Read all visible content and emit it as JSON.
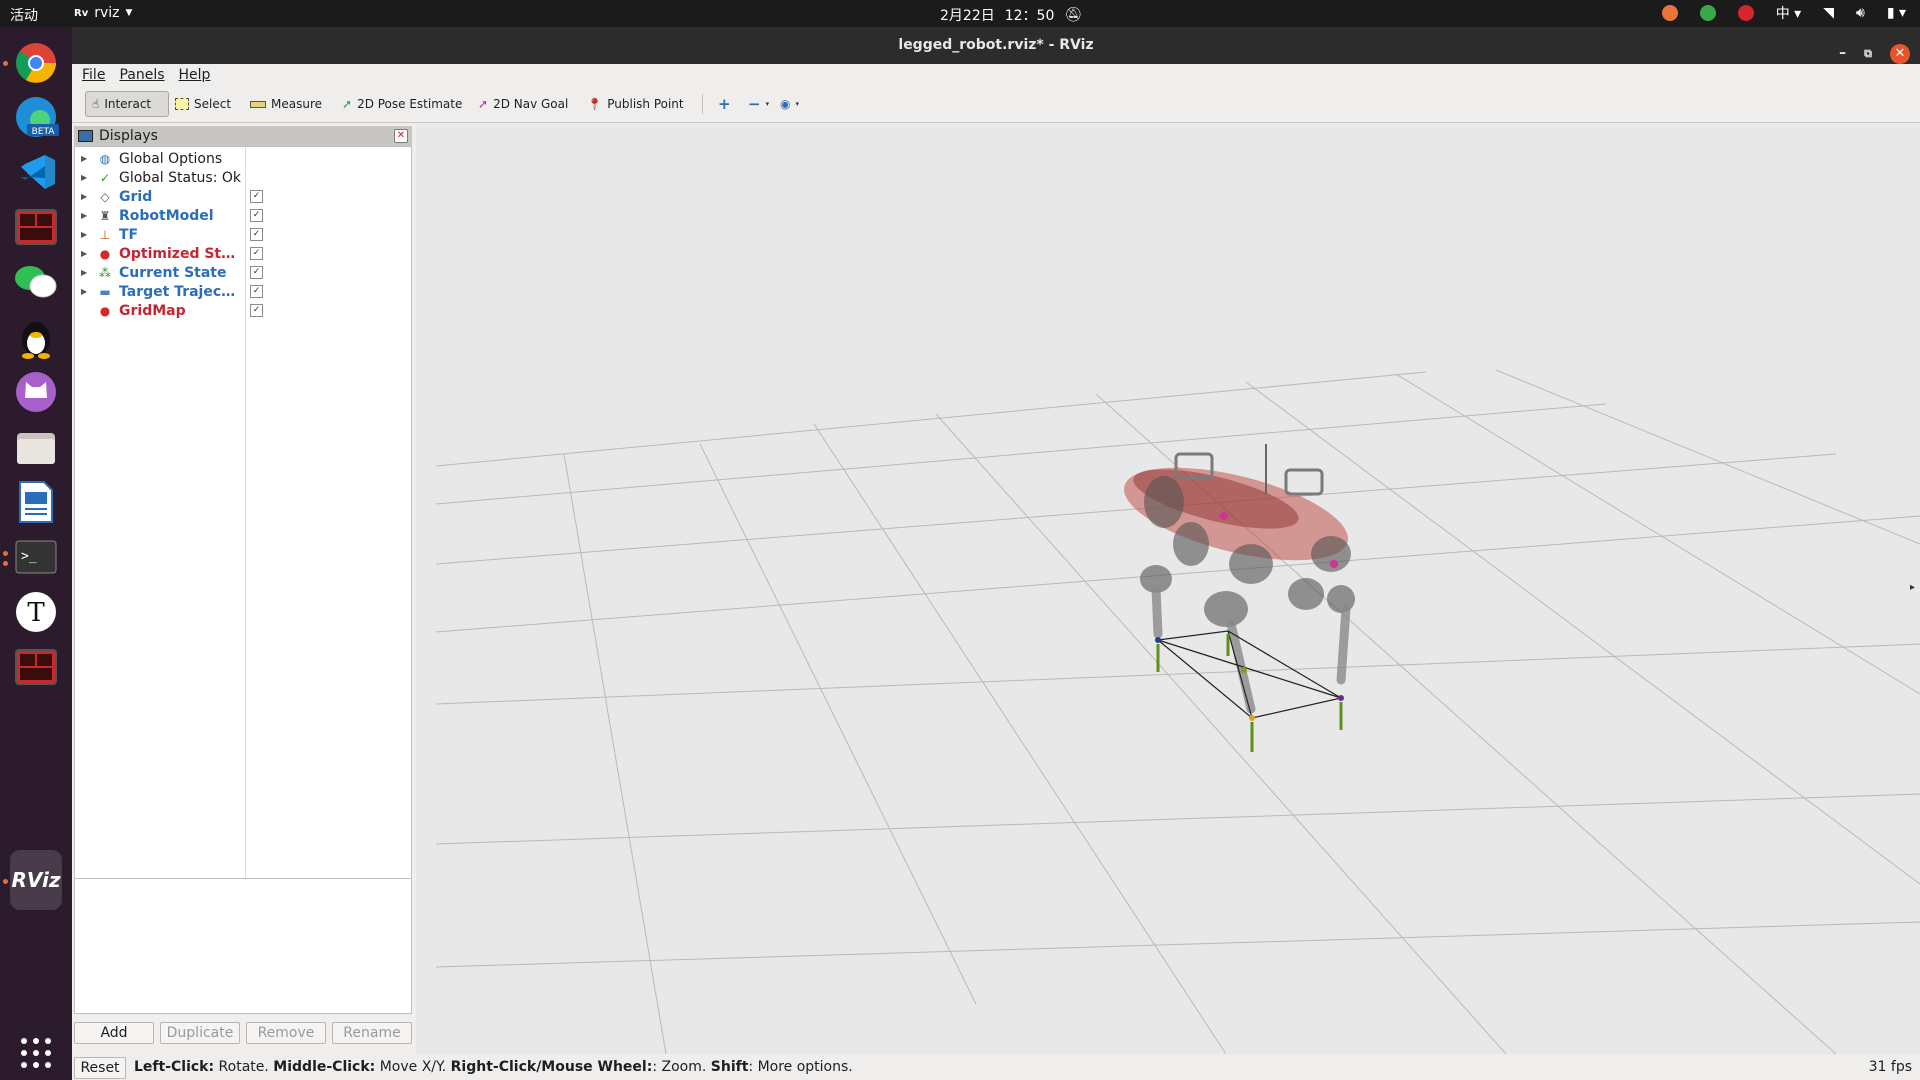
{
  "topbar": {
    "activities": "活动",
    "app_name": "rviz",
    "date": "2月22日",
    "time": "12：50",
    "input_method": "中"
  },
  "window": {
    "title": "legged_robot.rviz* - RViz"
  },
  "menu": {
    "file": "File",
    "panels": "Panels",
    "help": "Help"
  },
  "toolbar": {
    "interact": "Interact",
    "select": "Select",
    "measure": "Measure",
    "pose_estimate": "2D Pose Estimate",
    "nav_goal": "2D Nav Goal",
    "publish_point": "Publish Point"
  },
  "displays": {
    "header": "Displays",
    "items": [
      {
        "label": "Global Options",
        "style": "normal",
        "checkbox": false,
        "icon": "globe-icon",
        "color": "#2a6db8"
      },
      {
        "label": "Global Status: Ok",
        "style": "normal",
        "checkbox": false,
        "icon": "checkmark-icon",
        "color": "#2c9a3a"
      },
      {
        "label": "Grid",
        "style": "blue",
        "checkbox": true,
        "icon": "grid-icon",
        "color": "#555555"
      },
      {
        "label": "RobotModel",
        "style": "blue",
        "checkbox": true,
        "icon": "robot-icon",
        "color": "#555555"
      },
      {
        "label": "TF",
        "style": "blue",
        "checkbox": true,
        "icon": "axes-icon",
        "color": "#c9562b"
      },
      {
        "label": "Optimized Sta...",
        "style": "red",
        "checkbox": true,
        "icon": "error-icon",
        "color": "#d32a2a"
      },
      {
        "label": "Current State",
        "style": "blue",
        "checkbox": true,
        "icon": "markers-icon",
        "color": "#3a8a3a"
      },
      {
        "label": "Target Traject...",
        "style": "blue",
        "checkbox": true,
        "icon": "folder-icon",
        "color": "#4f7fbf"
      },
      {
        "label": "GridMap",
        "style": "red",
        "checkbox": true,
        "icon": "error-icon",
        "color": "#d32a2a"
      }
    ]
  },
  "panel_buttons": {
    "add": "Add",
    "duplicate": "Duplicate",
    "remove": "Remove",
    "rename": "Rename"
  },
  "status": {
    "reset": "Reset",
    "left_click_key": "Left-Click:",
    "left_click_val": "Rotate.",
    "middle_click_key": "Middle-Click:",
    "middle_click_val": "Move X/Y.",
    "right_click_key": "Right-Click/Mouse Wheel:",
    "right_click_val": ": Zoom.",
    "shift_key": "Shift",
    "shift_val": ": More options.",
    "fps": "31 fps"
  },
  "colors": {
    "dock_bg": "#2b1b2c",
    "topbar_bg": "#1b1b1b",
    "close_button": "#e9542c",
    "viewport_bg": "#e8e8e8"
  }
}
